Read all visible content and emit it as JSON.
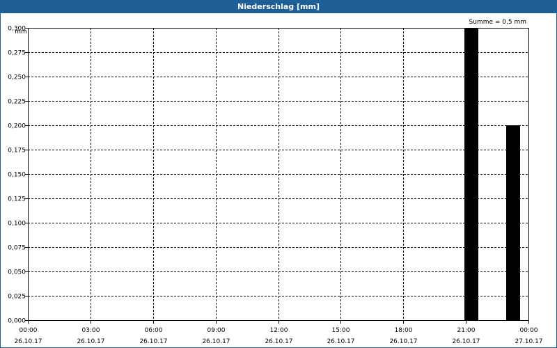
{
  "window": {
    "title": "Niederschlag [mm]"
  },
  "colors": {
    "titlebar": "#1f5f98",
    "bar": "#000000",
    "grid": "#000000"
  },
  "chart_data": {
    "type": "bar",
    "title": "Niederschlag [mm]",
    "ylabel": "mm",
    "xlabel": "",
    "annotation": "Summe = 0,5 mm",
    "grid": true,
    "ylim": [
      0,
      0.3
    ],
    "y_ticks": [
      "0,000",
      "0,025",
      "0,050",
      "0,075",
      "0,100",
      "0,125",
      "0,150",
      "0,175",
      "0,200",
      "0,225",
      "0,250",
      "0,275",
      "0,300"
    ],
    "xlim": [
      "2017-10-26 00:00",
      "2017-10-27 00:00"
    ],
    "x_ticks": [
      {
        "time": "00:00",
        "date": "26.10.17"
      },
      {
        "time": "03:00",
        "date": "26.10.17"
      },
      {
        "time": "06:00",
        "date": "26.10.17"
      },
      {
        "time": "09:00",
        "date": "26.10.17"
      },
      {
        "time": "12:00",
        "date": "26.10.17"
      },
      {
        "time": "15:00",
        "date": "26.10.17"
      },
      {
        "time": "18:00",
        "date": "26.10.17"
      },
      {
        "time": "21:00",
        "date": "26.10.17"
      },
      {
        "time": "00:00",
        "date": "27.10.17"
      }
    ],
    "bars": [
      {
        "time": "2017-10-26 21:00",
        "value": 0.3
      },
      {
        "time": "2017-10-26 23:00",
        "value": 0.2
      }
    ]
  }
}
